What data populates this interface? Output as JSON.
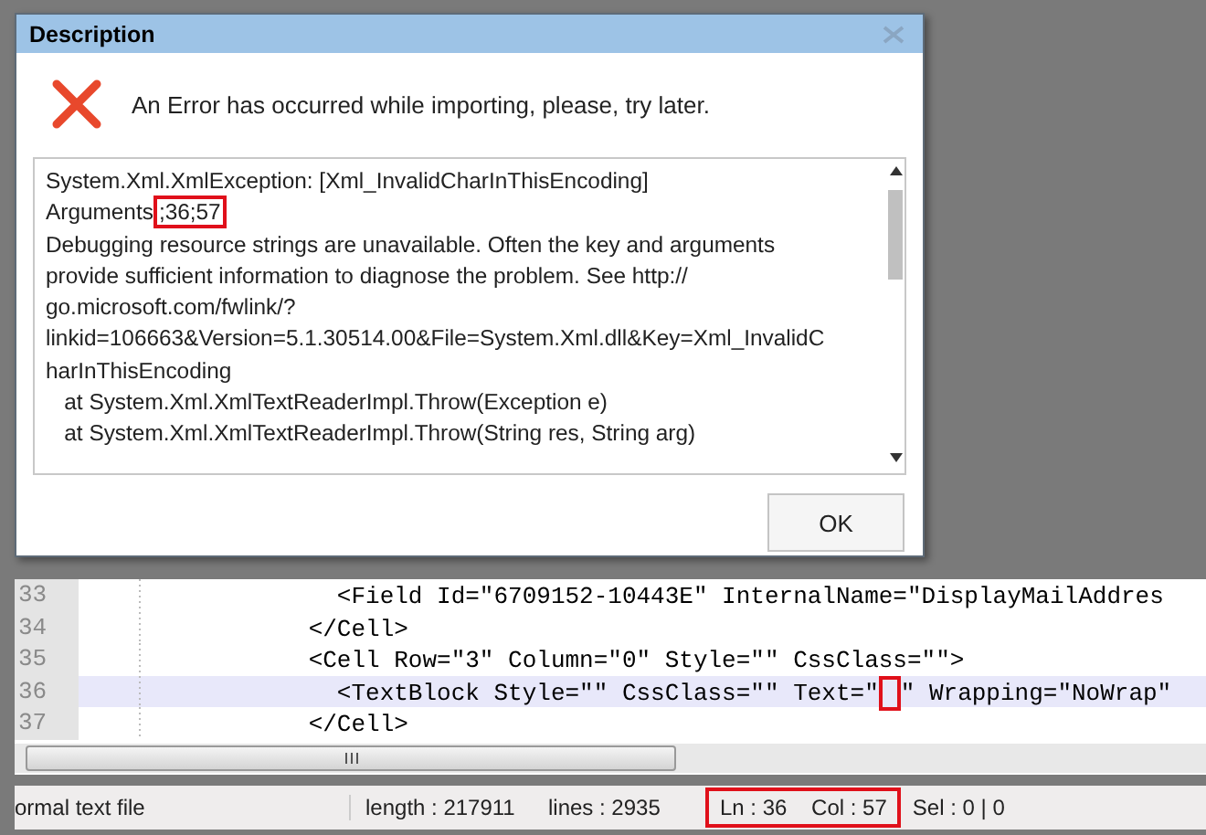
{
  "dialog": {
    "title": "Description",
    "message": "An Error has occurred while importing, please, try later.",
    "details": [
      {
        "text": "System.Xml.XmlException: [Xml_InvalidCharInThisEncoding]"
      },
      {
        "text": "Arguments",
        "highlight": ";36;57"
      },
      {
        "text": "Debugging resource strings are unavailable. Often the key and arguments"
      },
      {
        "text": "provide sufficient information to diagnose the problem. See http://"
      },
      {
        "text": "go.microsoft.com/fwlink/?"
      },
      {
        "text": "linkid=106663&Version=5.1.30514.00&File=System.Xml.dll&Key=Xml_InvalidC"
      },
      {
        "text": "harInThisEncoding"
      },
      {
        "text": "   at System.Xml.XmlTextReaderImpl.Throw(Exception e)"
      },
      {
        "text": "   at System.Xml.XmlTextReaderImpl.Throw(String res, String arg)"
      }
    ],
    "buttons": [
      "OK"
    ]
  },
  "editor": {
    "lines": [
      {
        "number": "33",
        "current": false,
        "text": "                  <Field Id=\"6709152-10443E\" InternalName=\"DisplayMailAddres"
      },
      {
        "number": "34",
        "current": false,
        "text": "                </Cell>"
      },
      {
        "number": "35",
        "current": false,
        "text": "                <Cell Row=\"3\" Column=\"0\" Style=\"\" CssClass=\"\">"
      },
      {
        "number": "36",
        "current": true,
        "text": "                  <TextBlock Style=\"\" CssClass=\"\" Text=\"",
        "flagged_char": true,
        "text_after": "\" Wrapping=\"NoWrap\""
      },
      {
        "number": "37",
        "current": false,
        "text": "                </Cell>"
      }
    ]
  },
  "status_bar": [
    {
      "text": "ormal text file",
      "highlight": false
    },
    {
      "text": "length : 217911",
      "highlight": false
    },
    {
      "text": "lines : 2935",
      "highlight": false
    },
    {
      "text": "Ln : 36    Col : 57",
      "highlight": true
    },
    {
      "text": "Sel : 0 | 0",
      "highlight": false
    }
  ]
}
